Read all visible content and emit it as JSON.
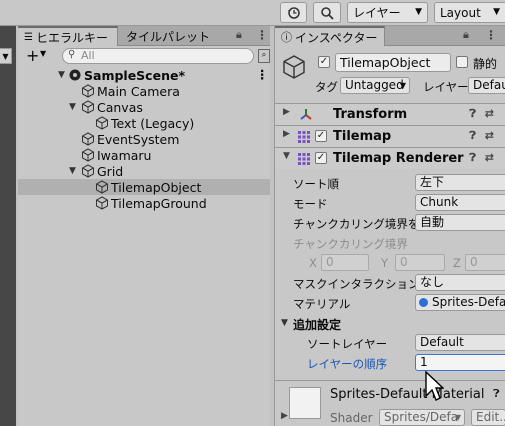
{
  "toolbar": {
    "history_icon": "history-icon",
    "search_icon": "search-icon",
    "layers_dropdown": "レイヤー",
    "layout_dropdown": "Layout"
  },
  "hierarchy": {
    "tab_hierarchy": "ヒエラルキー",
    "tab_tile_palette": "タイルパレット",
    "add_button": "+",
    "search_placeholder": "All",
    "scene_name": "SampleScene*",
    "items": [
      {
        "label": "Main Camera"
      },
      {
        "label": "Canvas"
      },
      {
        "label": "Text (Legacy)"
      },
      {
        "label": "EventSystem"
      },
      {
        "label": "Iwamaru"
      },
      {
        "label": "Grid"
      },
      {
        "label": "TilemapObject"
      },
      {
        "label": "TilemapGround"
      }
    ]
  },
  "inspector": {
    "tab_label": "インスペクター",
    "object_name": "TilemapObject",
    "static_label": "静的",
    "tag_label": "タグ",
    "tag_value": "Untagged",
    "layer_label": "レイヤー",
    "layer_value": "Defau",
    "components": {
      "transform": "Transform",
      "tilemap": "Tilemap",
      "tilemap_renderer": "Tilemap Renderer"
    },
    "props": {
      "sort_order_label": "ソート順",
      "sort_order_value": "左下",
      "mode_label": "モード",
      "mode_value": "Chunk",
      "chunk_culling_detect_label": "チャンクカリング境界を検出",
      "chunk_culling_detect_value": "自動",
      "chunk_culling_bounds_label": "チャンクカリング境界",
      "x_label": "X",
      "x_value": "0",
      "y_label": "Y",
      "y_value": "0",
      "z_label": "Z",
      "z_value": "0",
      "mask_interaction_label": "マスクインタラクション",
      "mask_interaction_value": "なし",
      "material_label": "マテリアル",
      "material_value": "Sprites-Defa"
    },
    "additional_settings": "追加設定",
    "sorting_layer_label": "ソートレイヤー",
    "sorting_layer_value": "Default",
    "order_in_layer_label": "レイヤーの順序",
    "order_in_layer_value": "1",
    "material_preview": {
      "title": "Sprites-Default Material",
      "shader_label": "Shader",
      "shader_value": "Sprites/Defa",
      "edit_button": "Edit..."
    }
  }
}
